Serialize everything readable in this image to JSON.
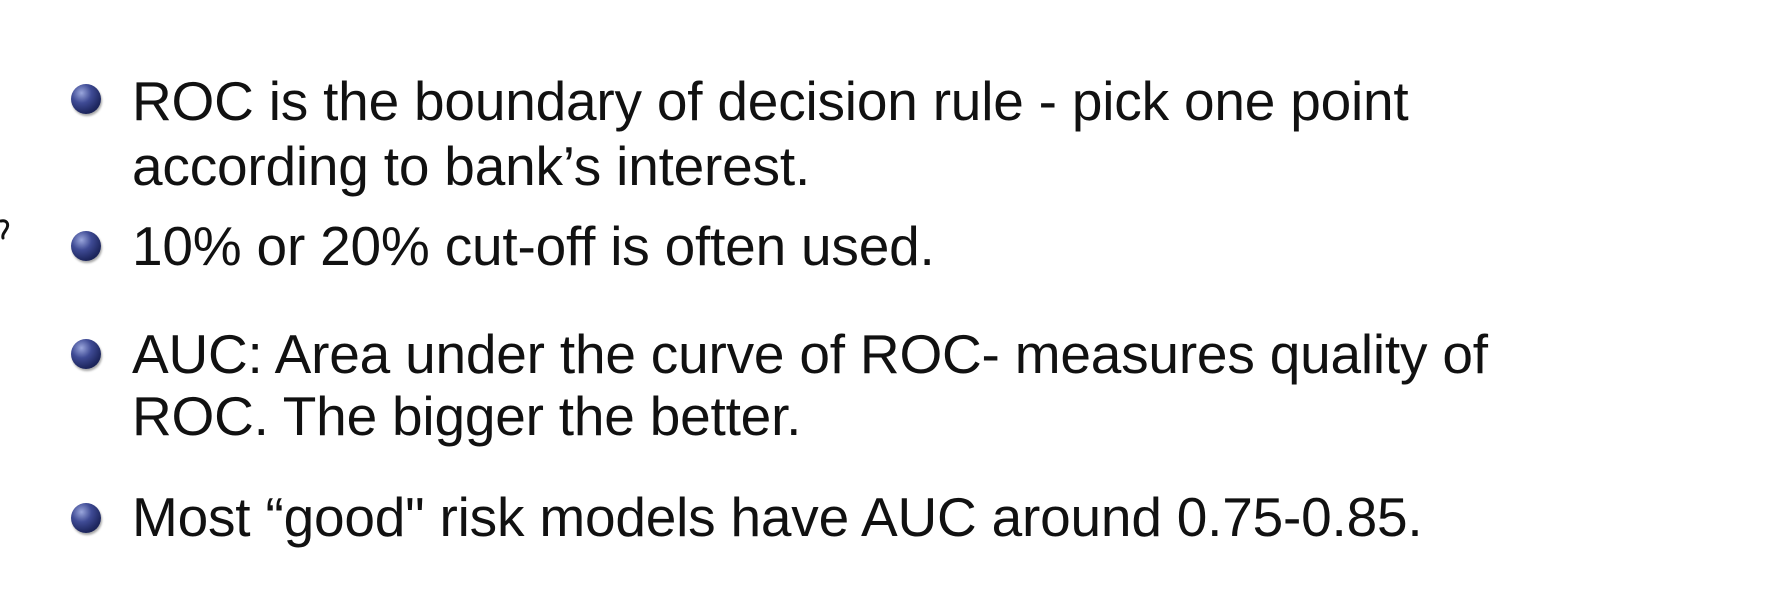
{
  "bullets": [
    {
      "line1": "ROC is the boundary of decision rule - pick one point",
      "line2": "according to bank’s interest."
    },
    {
      "line1": "10% or 20% cut-off is often used."
    },
    {
      "line1": "AUC: Area under the curve of ROC- measures quality of",
      "line2": "ROC. The bigger the better."
    },
    {
      "line1": "Most “good\" risk models have AUC around 0.75-0.85."
    }
  ],
  "bullet_icon": "bullet-circle-icon",
  "colors": {
    "text": "#111111",
    "bullet": "#2a3472",
    "background": "#ffffff"
  }
}
